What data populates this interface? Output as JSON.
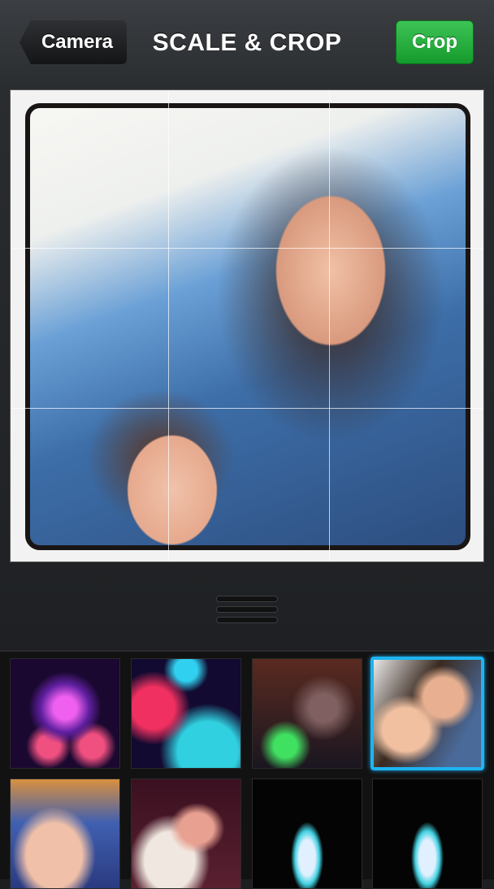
{
  "navbar": {
    "back_label": "Camera",
    "title": "SCALE & CROP",
    "crop_label": "Crop",
    "crop_color": "#2db344"
  },
  "editor": {
    "photo_description": "Selfie of smiling woman and young child",
    "grid": "3x3 rule-of-thirds overlay"
  },
  "gallery": {
    "selected_color": "#1eb4f0",
    "thumbnails": [
      {
        "description": "Glowing pink and purple glasses",
        "selected": false
      },
      {
        "description": "Glowing red and cyan glasses",
        "selected": false
      },
      {
        "description": "Child with glowing green glasses",
        "selected": false
      },
      {
        "description": "Woman and child selfie",
        "selected": true
      },
      {
        "description": "Smiling child at carousel",
        "selected": false
      },
      {
        "description": "Sleeping child",
        "selected": false
      },
      {
        "description": "Castle illuminated at night",
        "selected": false
      },
      {
        "description": "Castle illuminated at night",
        "selected": false
      }
    ]
  }
}
